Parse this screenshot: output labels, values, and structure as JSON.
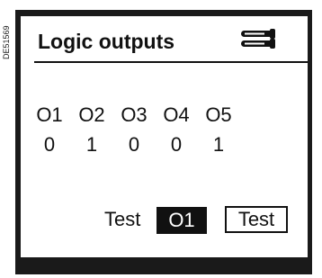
{
  "doc_ref": "DE51569",
  "screen": {
    "title": "Logic outputs",
    "title_icon": "keys-icon",
    "outputs": [
      {
        "label": "O1",
        "value": "0"
      },
      {
        "label": "O2",
        "value": "1"
      },
      {
        "label": "O3",
        "value": "0"
      },
      {
        "label": "O4",
        "value": "0"
      },
      {
        "label": "O5",
        "value": "1"
      }
    ],
    "test_label": "Test",
    "selected_output": "O1",
    "test_button_label": "Test"
  },
  "colors": {
    "bezel": "#1a1a1a",
    "screen": "#ffffff",
    "text": "#111111"
  }
}
